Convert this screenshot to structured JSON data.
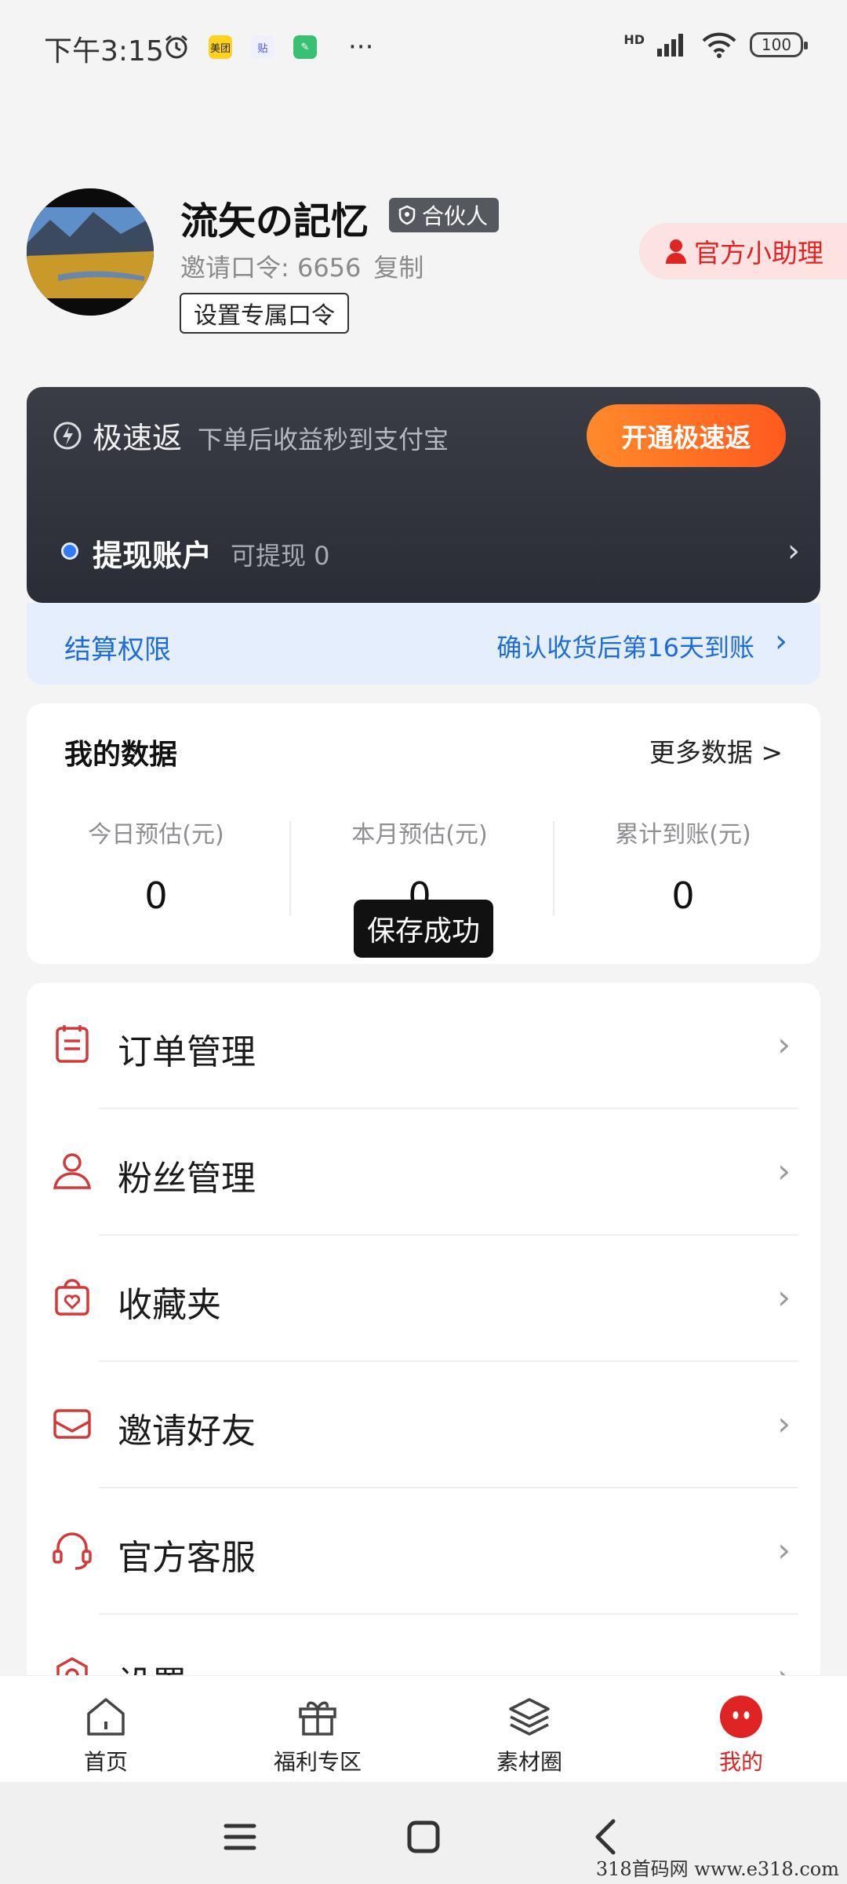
{
  "status_bar": {
    "time": "下午3:15",
    "mini_apps": [
      "美团",
      "贴",
      "✎"
    ],
    "network": "HD",
    "battery": "100"
  },
  "profile": {
    "nickname": "流矢の記忆",
    "badge": "合伙人",
    "invite_code_text": "邀请口令: 6656",
    "copy_label": "复制",
    "set_code_button": "设置专属口令",
    "helper_button": "官方小助理"
  },
  "fast_rebate": {
    "title": "极速返",
    "description": "下单后收益秒到支付宝",
    "button": "开通极速返"
  },
  "withdraw": {
    "title": "提现账户",
    "available": "可提现 0"
  },
  "settlement": {
    "label": "结算权限",
    "info": "确认收货后第16天到账"
  },
  "my_data": {
    "title": "我的数据",
    "more": "更多数据 >",
    "stats": [
      {
        "label": "今日预估(元)",
        "value": "0"
      },
      {
        "label": "本月预估(元)",
        "value": "0"
      },
      {
        "label": "累计到账(元)",
        "value": "0"
      }
    ]
  },
  "toast": "保存成功",
  "menu": [
    {
      "label": "订单管理",
      "icon": "order-icon"
    },
    {
      "label": "粉丝管理",
      "icon": "user-icon"
    },
    {
      "label": "收藏夹",
      "icon": "bag-heart-icon"
    },
    {
      "label": "邀请好友",
      "icon": "mail-icon"
    },
    {
      "label": "官方客服",
      "icon": "headset-icon"
    },
    {
      "label": "设置",
      "icon": "settings-icon"
    }
  ],
  "tabs": [
    {
      "label": "首页",
      "icon": "home-icon"
    },
    {
      "label": "福利专区",
      "icon": "gift-icon"
    },
    {
      "label": "素材圈",
      "icon": "layers-icon"
    },
    {
      "label": "我的",
      "icon": "mascot-icon"
    }
  ],
  "watermark": "318首码网  www.e318.com",
  "colors": {
    "accent": "#e02424",
    "link_blue": "#1f6cd9",
    "orange": "#ff6a22"
  }
}
